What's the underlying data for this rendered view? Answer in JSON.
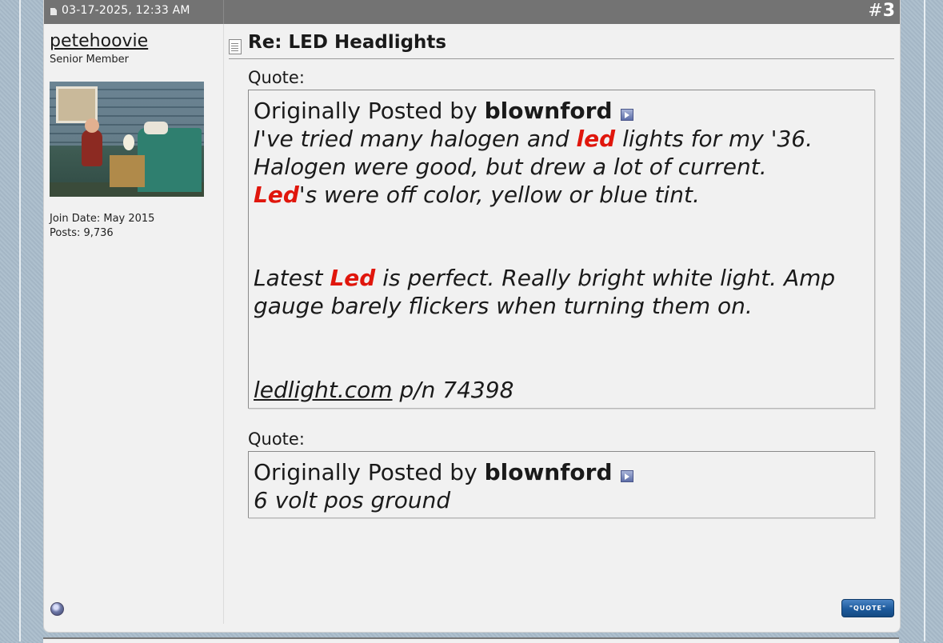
{
  "post": {
    "date": "03-17-2025, 12:33 AM",
    "number_hash": "#",
    "number": "3",
    "title": "Re: LED Headlights",
    "quote_button_label": "\"QUOTE\""
  },
  "user": {
    "username": "petehoovie",
    "rank": "Senior Member",
    "join_date": "Join Date: May 2015",
    "posts": "Posts: 9,736"
  },
  "quotes": [
    {
      "label": "Quote:",
      "originally_posted_by": "Originally Posted by",
      "author": "blownford",
      "lines": {
        "l1_pre": "I've tried many halogen and",
        "l1_hl": "led",
        "l1_post": "lights for my '36.",
        "l2": "Halogen were good, but drew a lot of current.",
        "l3_hl": "Led",
        "l3_post": "'s were off color, yellow or blue tint.",
        "l4_pre": "Latest",
        "l4_hl": "Led",
        "l4_post": "is perfect. Really bright white light. Amp",
        "l5": "gauge barely flickers when turning them on.",
        "l6_link": "ledlight.com",
        "l6_post": "p/n 74398"
      }
    },
    {
      "label": "Quote:",
      "originally_posted_by": "Originally Posted by",
      "author": "blownford",
      "lines": {
        "l1": "6 volt pos ground"
      }
    }
  ],
  "icons": {
    "status": "post-status-icon",
    "doc": "post-icon",
    "view_post": "view-post-arrow-icon",
    "online": "user-offline-icon"
  },
  "colors": {
    "header_bg": "#737373",
    "highlight": "#e0160c",
    "quote_button": "#1d5a9c"
  }
}
